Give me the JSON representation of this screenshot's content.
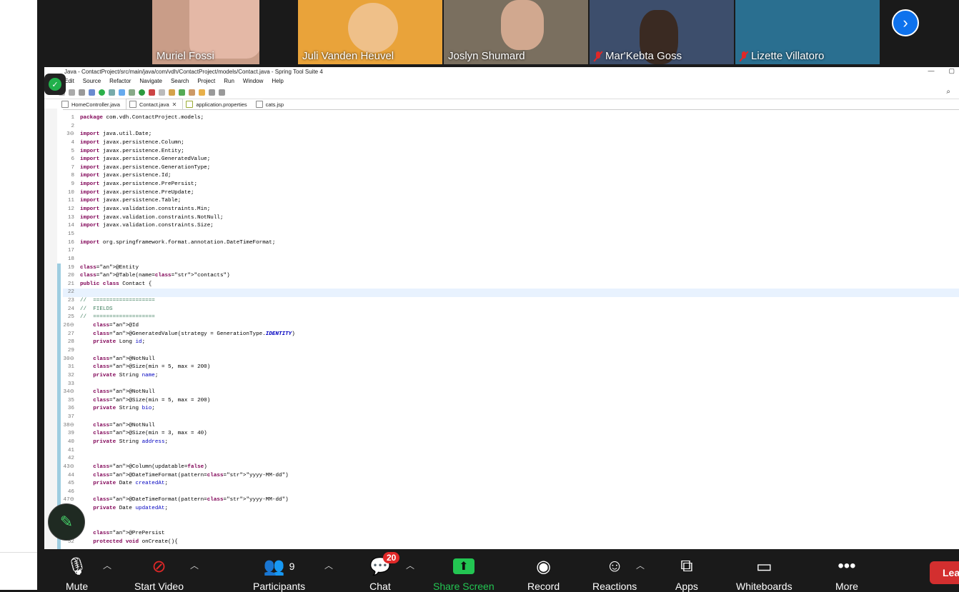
{
  "participants_tiles": [
    {
      "name": "Muriel Fossi",
      "muted": false,
      "bg": "#caa08c"
    },
    {
      "name": "Juli Vanden Heuvel",
      "muted": false,
      "bg": "#e9a33a"
    },
    {
      "name": "Joslyn Shumard",
      "muted": false,
      "bg": "#6f6a5a"
    },
    {
      "name": "Mar'Kebta Goss",
      "muted": true,
      "bg": "#3a4a66"
    },
    {
      "name": "Lizette Villatoro",
      "muted": true,
      "bg": "#2d6b8a"
    }
  ],
  "ide": {
    "title": "Java - ContactProject/src/main/java/com/vdh/ContactProject/models/Contact.java - Spring Tool Suite 4",
    "menu": [
      "Edit",
      "Source",
      "Refactor",
      "Navigate",
      "Search",
      "Project",
      "Run",
      "Window",
      "Help"
    ],
    "tabs": [
      {
        "label": "HomeController.java",
        "active": false
      },
      {
        "label": "Contact.java",
        "active": true
      },
      {
        "label": "application.properties",
        "active": false
      },
      {
        "label": "cats.jsp",
        "active": false
      }
    ]
  },
  "code_lines": [
    {
      "n": "1",
      "t": "package com.vdh.ContactProject.models;"
    },
    {
      "n": "2",
      "t": ""
    },
    {
      "n": "3⊖",
      "t": "import java.util.Date;"
    },
    {
      "n": "4",
      "t": "import javax.persistence.Column;"
    },
    {
      "n": "5",
      "t": "import javax.persistence.Entity;"
    },
    {
      "n": "6",
      "t": "import javax.persistence.GeneratedValue;"
    },
    {
      "n": "7",
      "t": "import javax.persistence.GenerationType;"
    },
    {
      "n": "8",
      "t": "import javax.persistence.Id;"
    },
    {
      "n": "9",
      "t": "import javax.persistence.PrePersist;"
    },
    {
      "n": "10",
      "t": "import javax.persistence.PreUpdate;"
    },
    {
      "n": "11",
      "t": "import javax.persistence.Table;"
    },
    {
      "n": "12",
      "t": "import javax.validation.constraints.Min;"
    },
    {
      "n": "13",
      "t": "import javax.validation.constraints.NotNull;"
    },
    {
      "n": "14",
      "t": "import javax.validation.constraints.Size;"
    },
    {
      "n": "15",
      "t": ""
    },
    {
      "n": "16",
      "t": "import org.springframework.format.annotation.DateTimeFormat;"
    },
    {
      "n": "17",
      "t": ""
    },
    {
      "n": "18",
      "t": ""
    },
    {
      "n": "19",
      "t": "@Entity"
    },
    {
      "n": "20",
      "t": "@Table(name=\"contacts\")"
    },
    {
      "n": "21",
      "t": "public class Contact {"
    },
    {
      "n": "22",
      "t": ""
    },
    {
      "n": "23",
      "t": "//  ==================="
    },
    {
      "n": "24",
      "t": "//  FIELDS"
    },
    {
      "n": "25",
      "t": "//  ==================="
    },
    {
      "n": "26⊖",
      "t": "    @Id"
    },
    {
      "n": "27",
      "t": "    @GeneratedValue(strategy = GenerationType.IDENTITY)"
    },
    {
      "n": "28",
      "t": "    private Long id;"
    },
    {
      "n": "29",
      "t": ""
    },
    {
      "n": "30⊖",
      "t": "    @NotNull"
    },
    {
      "n": "31",
      "t": "    @Size(min = 5, max = 200)"
    },
    {
      "n": "32",
      "t": "    private String name;"
    },
    {
      "n": "33",
      "t": ""
    },
    {
      "n": "34⊖",
      "t": "    @NotNull"
    },
    {
      "n": "35",
      "t": "    @Size(min = 5, max = 200)"
    },
    {
      "n": "36",
      "t": "    private String bio;"
    },
    {
      "n": "37",
      "t": ""
    },
    {
      "n": "38⊖",
      "t": "    @NotNull"
    },
    {
      "n": "39",
      "t": "    @Size(min = 3, max = 40)"
    },
    {
      "n": "40",
      "t": "    private String address;"
    },
    {
      "n": "41",
      "t": ""
    },
    {
      "n": "42",
      "t": ""
    },
    {
      "n": "43⊖",
      "t": "    @Column(updatable=false)"
    },
    {
      "n": "44",
      "t": "    @DateTimeFormat(pattern=\"yyyy-MM-dd\")"
    },
    {
      "n": "45",
      "t": "    private Date createdAt;"
    },
    {
      "n": "46",
      "t": ""
    },
    {
      "n": "47⊖",
      "t": "    @DateTimeFormat(pattern=\"yyyy-MM-dd\")"
    },
    {
      "n": "48",
      "t": "    private Date updatedAt;"
    },
    {
      "n": "49",
      "t": ""
    },
    {
      "n": "50",
      "t": ""
    },
    {
      "n": "51⊖",
      "t": "    @PrePersist"
    },
    {
      "n": "52",
      "t": "    protected void onCreate(){"
    }
  ],
  "toolbar": {
    "mute": "Mute",
    "start_video": "Start Video",
    "participants": "Participants",
    "participants_count": "9",
    "chat": "Chat",
    "chat_badge": "20",
    "share_screen": "Share Screen",
    "record": "Record",
    "reactions": "Reactions",
    "apps": "Apps",
    "whiteboards": "Whiteboards",
    "more": "More",
    "leave": "Lea"
  },
  "icons": {
    "mute": "microphone-icon",
    "video": "video-off-icon",
    "participants": "people-icon",
    "chat": "chat-bubble-icon",
    "share": "share-arrow-icon",
    "record": "record-icon",
    "reactions": "emoji-plus-icon",
    "apps": "apps-icon",
    "whiteboards": "whiteboard-icon",
    "more": "ellipsis-icon"
  }
}
